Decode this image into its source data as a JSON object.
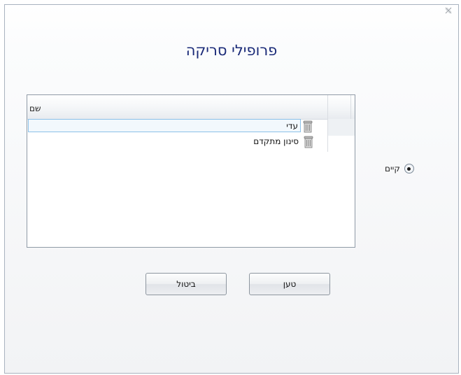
{
  "dialog": {
    "title": "פרופילי סריקה",
    "close_icon": "close-icon"
  },
  "option": {
    "label": "קיים",
    "selected": true
  },
  "list": {
    "column_header": "שם",
    "rows": [
      {
        "name": "עדי",
        "icon": "trash-icon",
        "selected": true
      },
      {
        "name": "סינון מתקדם",
        "icon": "trash-icon",
        "selected": false
      }
    ]
  },
  "buttons": {
    "cancel_label": "ביטול",
    "load_label": "טען"
  }
}
